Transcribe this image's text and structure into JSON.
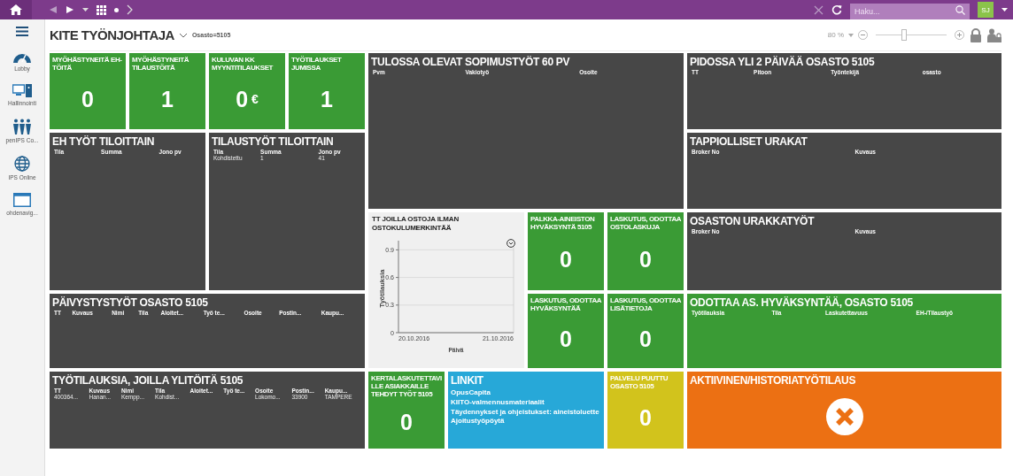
{
  "topbar": {
    "search": {
      "placeholder": "Haku..."
    },
    "avatar": "SJ"
  },
  "sidebar": {
    "items": [
      {
        "label": "Lobby"
      },
      {
        "label": "Hallinnointi"
      },
      {
        "label": "penIPS Co..."
      },
      {
        "label": "IPS Online"
      },
      {
        "label": "ohdenavig..."
      }
    ]
  },
  "header": {
    "title": "KITE TYÖNJOHTAJA",
    "filter": "Osasto=5105",
    "zoom": {
      "reading": "80 %",
      "level": 0.4
    }
  },
  "tiles": [
    {
      "kind": "counter",
      "color": "#3a9b35",
      "title": "MYÖHÄSTYNEITÄ EH-TÖITÄ",
      "value": "0"
    },
    {
      "kind": "counter",
      "color": "#3a9b35",
      "title": "MYÖHÄSTYNEITÄ TILAUSTÖITÄ",
      "value": "1"
    },
    {
      "kind": "counter",
      "color": "#3a9b35",
      "title": "KULUVAN KK MYYNTITILAUKSET",
      "value": "0",
      "unit": "€"
    },
    {
      "kind": "counter",
      "color": "#3a9b35",
      "title": "TYÖTILAUKSET JUMISSA",
      "value": "1"
    },
    {
      "kind": "table",
      "color": "#474747",
      "title": "TULOSSA OLEVAT SOPIMUSTYÖT 60 PV",
      "columns": [
        "Pvm",
        "Vakiotyö",
        "Osoite"
      ]
    },
    {
      "kind": "table",
      "color": "#474747",
      "title": "PIDOSSA YLI 2 PÄIVÄÄ OSASTO 5105",
      "columns": [
        "TT",
        "Pitoon",
        "Työntekijä",
        "osasto"
      ]
    },
    {
      "kind": "table",
      "color": "#474747",
      "title": "EH TYÖT TILOITTAIN",
      "columns": [
        "Tila",
        "Summa",
        "Jono pv"
      ]
    },
    {
      "kind": "table",
      "color": "#474747",
      "title": "TILAUSTYÖT TILOITTAIN",
      "columns": [
        "Tila",
        "Summa",
        "Jono pv"
      ],
      "rows": [
        [
          "Kohdistettu",
          "1",
          "41"
        ]
      ]
    },
    {
      "kind": "table",
      "color": "#474747",
      "title": "TAPPIOLLISET URAKAT",
      "columns": [
        "Broker No",
        "Kuvaus"
      ]
    },
    {
      "kind": "chart",
      "color": "#f0f0f0",
      "title": "TT JOILLA OSTOJA ILMAN OSTOKULUMERKINTÄÄ",
      "chart_data": {
        "type": "line",
        "xlabel": "Päivä",
        "ylabel": "Työtilauksia",
        "ylim": [
          0,
          1
        ],
        "yticks": [
          0,
          0.3,
          0.6,
          0.9
        ],
        "categories": [
          "20.10.2016",
          "21.10.2016"
        ],
        "grid": true
      }
    },
    {
      "kind": "counter",
      "color": "#3a9b35",
      "title": "PALKKA-AINEISTON HYVÄKSYNTÄ 5105",
      "value": "0"
    },
    {
      "kind": "counter",
      "color": "#3a9b35",
      "title": "LASKUTUS, ODOTTAA OSTOLASKUJA",
      "value": "0"
    },
    {
      "kind": "table",
      "color": "#474747",
      "title": "OSASTON URAKKATYÖT",
      "columns": [
        "Broker No",
        "Kuvaus"
      ]
    },
    {
      "kind": "table",
      "color": "#474747",
      "title": "PÄIVYSTYSTYÖT OSASTO 5105",
      "columns": [
        "TT",
        "Kuvaus",
        "Nimi",
        "Tila",
        "Aloitet...",
        "Työ te...",
        "Osoite",
        "Postin...",
        "Kaupu..."
      ]
    },
    {
      "kind": "counter",
      "color": "#3a9b35",
      "title": "LASKUTUS, ODOTTAA HYVÄKSYNTÄÄ",
      "value": "0"
    },
    {
      "kind": "counter",
      "color": "#3a9b35",
      "title": "LASKUTUS, ODOTTAA LISÄTIETOJA",
      "value": "0"
    },
    {
      "kind": "table",
      "color": "#3a9b35",
      "title": "ODOTTAA AS. HYVÄKSYNTÄÄ, OSASTO 5105",
      "columns": [
        "Työtilauksia",
        "Tila",
        "Laskutettavuus",
        "EH-/Tilaustyö"
      ]
    },
    {
      "kind": "table",
      "color": "#474747",
      "title": "TYÖTILAUKSIA, JOILLA YLITÖITÄ 5105",
      "columns": [
        "TT",
        "Kuvaus",
        "Nimi",
        "Tila",
        "Aloitet...",
        "Työ te...",
        "Osoite",
        "Postin...",
        "Kaupu..."
      ],
      "rows": [
        [
          "400364...",
          "Hanan...",
          "Kempp...",
          "Kohdist...",
          "",
          "",
          "Lokomo...",
          "33900",
          "TAMPERE"
        ]
      ]
    },
    {
      "kind": "counter",
      "color": "#3a9b35",
      "title": "KERTALASKUTETTAVILLE ASIAKKAILLE TEHDYT TYÖT 5105",
      "value": "0"
    },
    {
      "kind": "links",
      "color": "#27a8d8",
      "title": "LINKIT",
      "links": [
        "OpusCapita",
        "KIITO-valmennusmateriaalit",
        "Täydennykset ja ohjeistukset: aineistoluette",
        "Ajoitustyöpöytä"
      ]
    },
    {
      "kind": "counter",
      "color": "#d2c31c",
      "title": "PALVELU PUUTTU OSASTO 5105",
      "value": "0"
    },
    {
      "kind": "action",
      "color": "#ec7013",
      "title": "AKTIIVINEN/HISTORIATYÖTILAUS"
    }
  ]
}
